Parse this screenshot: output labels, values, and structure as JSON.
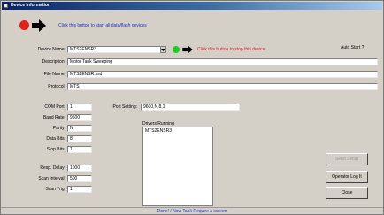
{
  "window": {
    "title": "Device Information"
  },
  "header": {
    "start_hint": "Click this button to start all data/flash devices"
  },
  "device": {
    "name_label": "Device Name:",
    "name_value": "MTS2ENSR3",
    "stop_hint": "Click this button to stop this device",
    "auto_start_label": "Auto Start ?",
    "description_label": "Description:",
    "description_value": "Motor Tank Sweeping",
    "file_name_label": "File Name:",
    "file_name_value": "MTS2ENSR.ssd",
    "protocol_label": "Protocol:",
    "protocol_value": "MTS"
  },
  "com": {
    "com_port_label": "COM Port:",
    "com_port_value": "1",
    "baud_rate_label": "Baud Rate:",
    "baud_rate_value": "9600",
    "parity_label": "Parity:",
    "parity_value": "N",
    "data_bits_label": "Data Bits:",
    "data_bits_value": "8",
    "stop_bits_label": "Stop Bits:",
    "stop_bits_value": "1",
    "port_setting_label": "Port Setting:",
    "port_setting_value": "9600,N,8,1"
  },
  "timing": {
    "resp_delay_label": "Resp. Delay:",
    "resp_delay_value": "1000",
    "scan_interval_label": "Scan Interval:",
    "scan_interval_value": "500",
    "scan_trig_label": "Scan Trig:",
    "scan_trig_value": "1"
  },
  "drivers": {
    "label": "Drivers Running",
    "items": [
      "MTS2ENSR3"
    ]
  },
  "buttons": {
    "send_setup": "Send Setup",
    "operator_log": "Operator Log It",
    "close": "Close"
  },
  "status": {
    "text": "Done! / Now Tank Require a screen"
  },
  "colors": {
    "accent_blue": "#2030c8",
    "accent_red": "#e02020",
    "start_dot": "#e3201b",
    "stop_dot": "#19d11e"
  }
}
